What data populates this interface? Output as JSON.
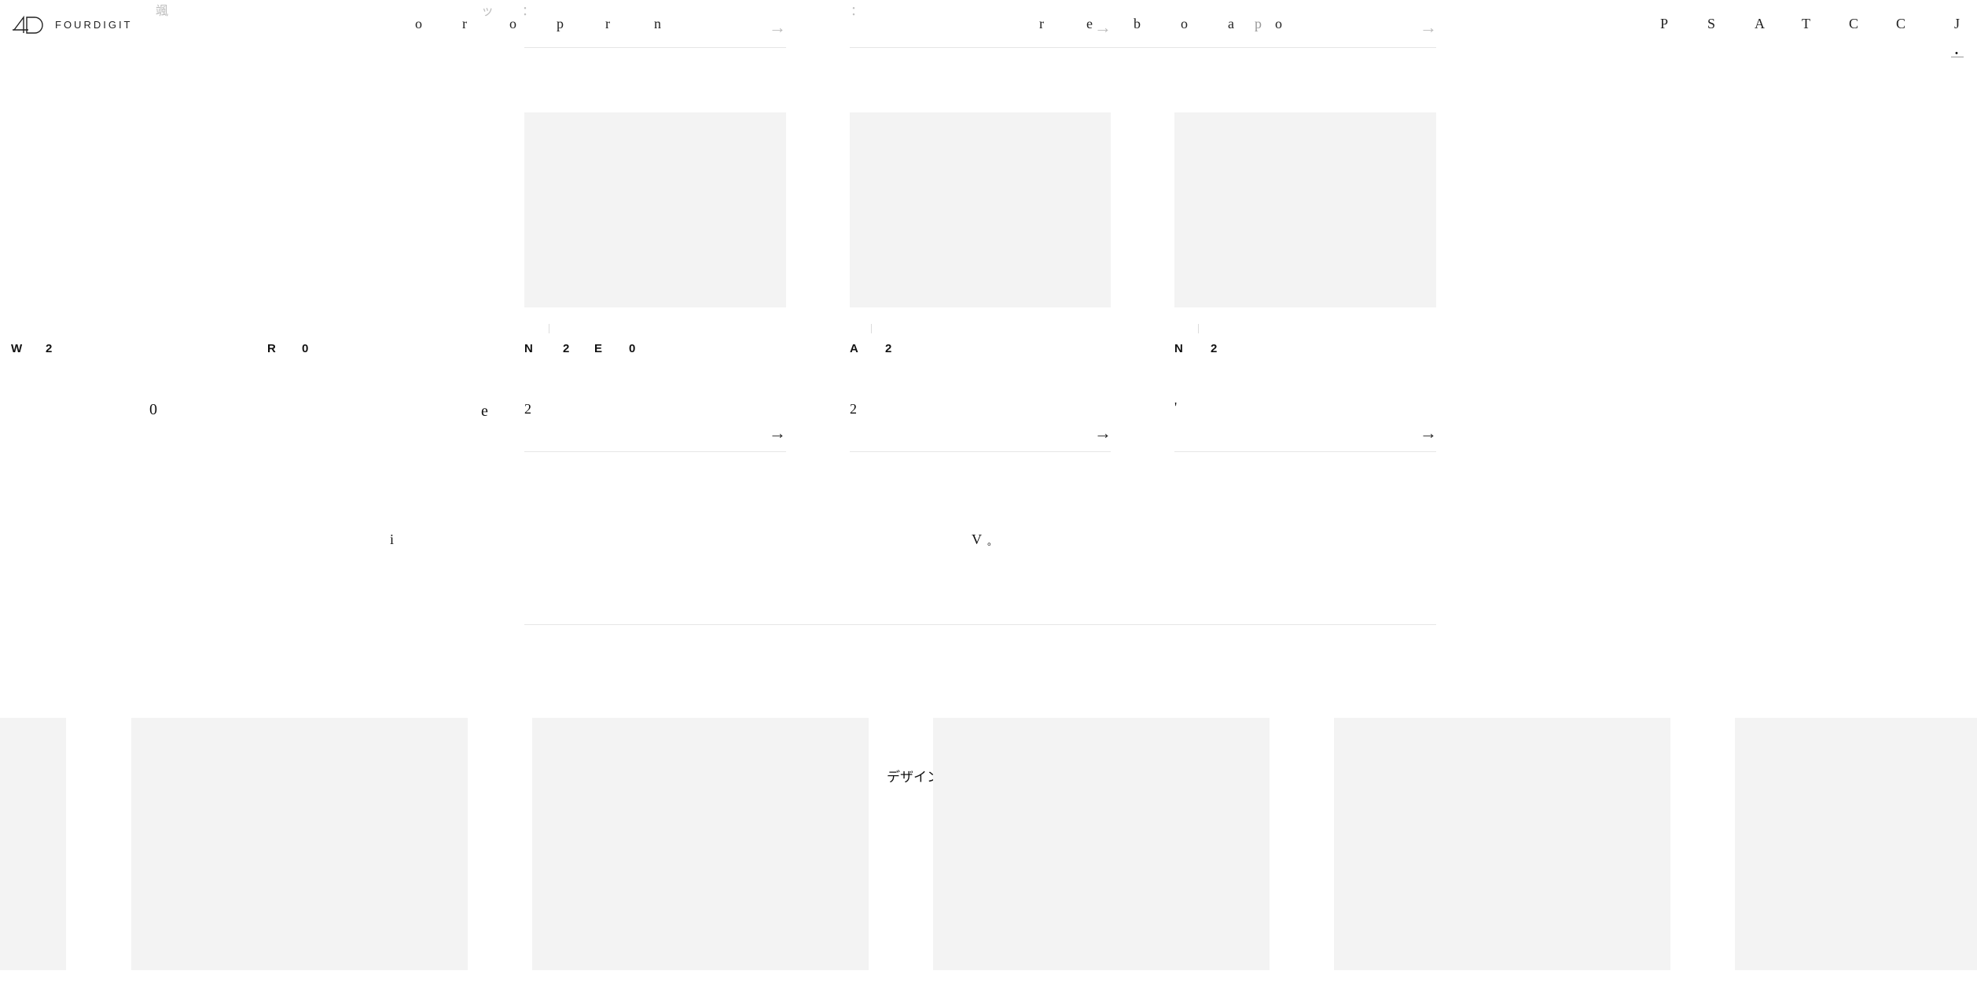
{
  "header": {
    "logo_text": "FOURDIGIT",
    "faint_top": [
      "颯",
      "ッ",
      "：",
      "："
    ],
    "nav_group1": [
      "o",
      "r",
      "o",
      "p",
      "r",
      "n"
    ],
    "nav_group2": [
      "r",
      "e",
      "b",
      "o",
      "a",
      "p",
      "o"
    ],
    "nav_right": [
      "P",
      "S",
      "A",
      "T",
      "C",
      "C",
      "J"
    ],
    "lang_mark": "・"
  },
  "left_labels": {
    "w": "W",
    "w2": "2",
    "r": "R",
    "r0": "0",
    "zero": "0",
    "e": "e",
    "i": "i"
  },
  "cards": [
    {
      "label_chars": [
        "N",
        "2",
        "E",
        "0"
      ],
      "text_fragment": "2",
      "arrow": "→"
    },
    {
      "label_chars": [
        "A",
        "2"
      ],
      "text_fragment": "2",
      "arrow": "→"
    },
    {
      "label_chars": [
        "N",
        "2"
      ],
      "text_fragment": "'",
      "arrow": "→"
    }
  ],
  "top_arrows": [
    "→",
    "→",
    "→"
  ],
  "mid_text": {
    "v": "V",
    "dot": "。"
  },
  "carousel": {
    "caption": "デザイン"
  },
  "colors": {
    "placeholder": "#f3f3f3",
    "rule": "#e6e6e6",
    "text": "#111111"
  }
}
